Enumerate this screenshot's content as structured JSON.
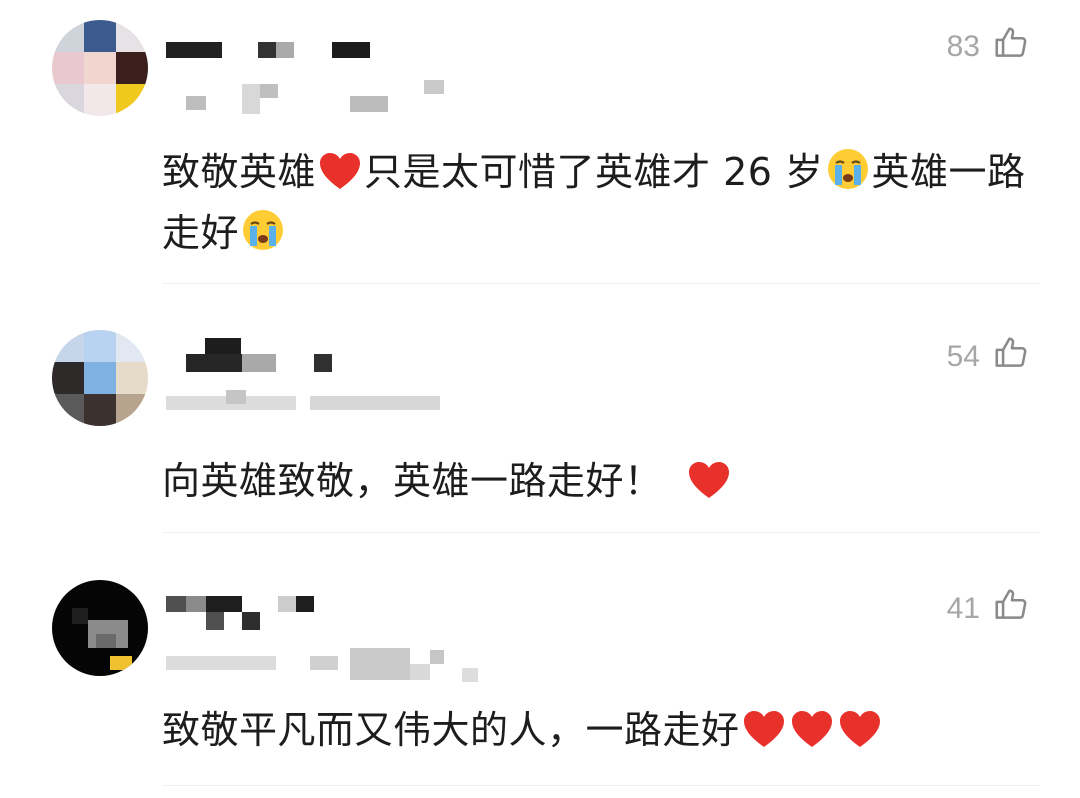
{
  "comments": [
    {
      "likes": "83",
      "text_parts": [
        "致敬英雄",
        "只是太可惜了英雄才 26 岁",
        "英雄一路走好",
        ""
      ],
      "emojis": [
        "heart",
        "crying-face",
        "crying-face"
      ]
    },
    {
      "likes": "54",
      "text_parts": [
        "向英雄致敬，英雄一路走好！",
        ""
      ],
      "emojis": [
        "heart"
      ]
    },
    {
      "likes": "41",
      "text_parts": [
        "致敬平凡而又伟大的人，一路走好",
        "",
        "",
        ""
      ],
      "emojis": [
        "heart",
        "heart",
        "heart"
      ]
    }
  ],
  "icons": {
    "like": "thumbs-up-outline-icon"
  },
  "colors": {
    "likes_text": "#a6a6a6",
    "heart": "#e8312b",
    "body_text": "#1d1d1d"
  }
}
